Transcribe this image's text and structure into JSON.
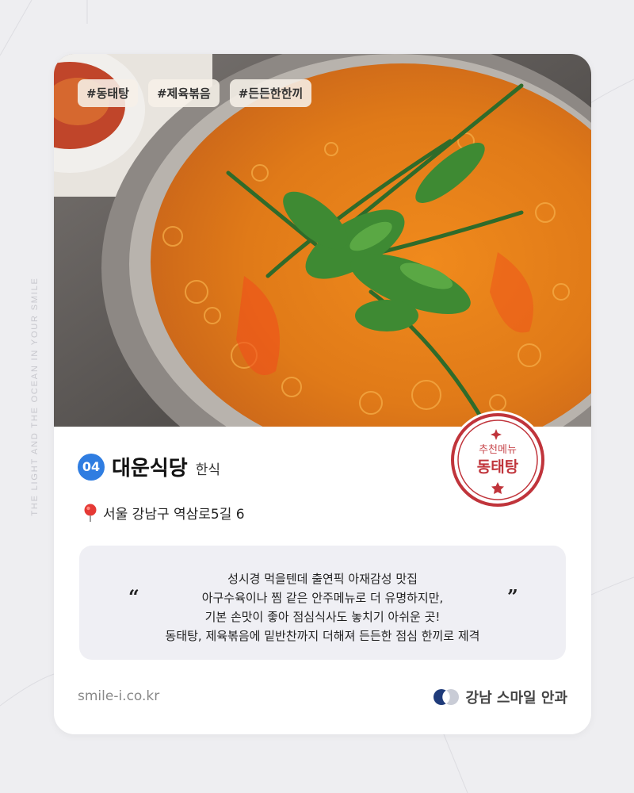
{
  "side_text": "THE LIGHT AND THE OCEAN IN YOUR SMILE",
  "tags": [
    "#동태탕",
    "#제육볶음",
    "#든든한한끼"
  ],
  "stamp": {
    "line1": "추천메뉴",
    "line2": "동태탕"
  },
  "restaurant": {
    "number": "04",
    "name": "대운식당",
    "category": "한식",
    "address": "서울 강남구 역삼로5길 6"
  },
  "quote": {
    "open_mark": "“",
    "close_mark": "”",
    "lines": [
      "성시경 먹을텐데 출연픽 아재감성 맛집",
      "아구수육이나 찜 같은 안주메뉴로 더 유명하지만,",
      "기본 손맛이 좋아 점심식사도 놓치기 아쉬운 곳!",
      "동태탕, 제육볶음에 밑반찬까지 더해져 든든한 점심 한끼로 제격"
    ]
  },
  "footer": {
    "website": "smile-i.co.kr",
    "brand": "강남 스마일 안과"
  },
  "colors": {
    "badge": "#2f7de1",
    "stamp": "#c0343b",
    "soup": "#e8801e"
  },
  "icons": {
    "location": "pin-icon",
    "brand": "brand-logo-icon"
  }
}
